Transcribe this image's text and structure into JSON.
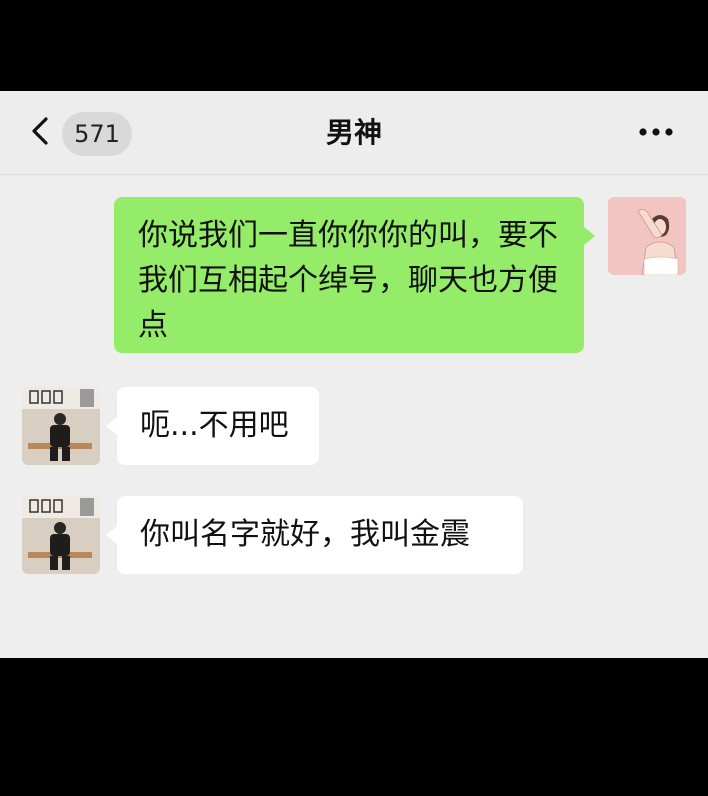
{
  "header": {
    "back_icon": "chevron-left-icon",
    "unread_count": "571",
    "title": "男神",
    "more_icon": "more-dots-icon"
  },
  "messages": [
    {
      "side": "right",
      "text": "你说我们一直你你你的叫，要不我们互相起个绰号，聊天也方便点"
    },
    {
      "side": "left",
      "text": "呃...不用吧"
    },
    {
      "side": "left",
      "text": "你叫名字就好，我叫金震"
    }
  ],
  "colors": {
    "background": "#eeeeee",
    "outgoing_bubble": "#95ec69",
    "incoming_bubble": "#ffffff",
    "frame": "#000000"
  }
}
